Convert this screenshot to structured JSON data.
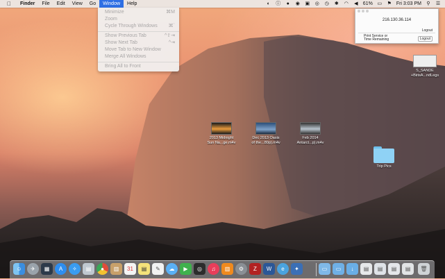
{
  "menubar": {
    "apple": "",
    "app_name": "Finder",
    "menus": [
      "File",
      "Edit",
      "View",
      "Go",
      "Window",
      "Help"
    ],
    "active_menu": "Window",
    "battery": "61%",
    "clock": "Fri 3:03 PM"
  },
  "window_menu": {
    "items": [
      {
        "label": "Minimize",
        "shortcut": "⌘M"
      },
      {
        "label": "Zoom",
        "shortcut": ""
      },
      {
        "label": "Cycle Through Windows",
        "shortcut": "⌘`"
      },
      {
        "label": "Show Previous Tab",
        "shortcut": "^⇧⇥"
      },
      {
        "label": "Show Next Tab",
        "shortcut": "^⇥"
      },
      {
        "label": "Move Tab to New Window",
        "shortcut": ""
      },
      {
        "label": "Merge All Windows",
        "shortcut": ""
      },
      {
        "label": "Bring All to Front",
        "shortcut": ""
      }
    ]
  },
  "popup_window": {
    "ip": "216.130.36.114",
    "logout_label": "Logout",
    "print_label_1": "Print Service or",
    "print_label_2": "Time Remaining",
    "logout_button": "Logout"
  },
  "desktop_icons": [
    {
      "line1": "2013 Midnight",
      "line2": "Sun Na...ge.m4v"
    },
    {
      "line1": "Dec 2013 Oasis",
      "line2": "of the...80p).m4v"
    },
    {
      "line1": "Feb 2014",
      "line2": "Antarct...p).m4v"
    },
    {
      "line1": "Trip Pics",
      "line2": ""
    },
    {
      "line1": "S_SANDE",
      "line2": "+BirisA...ndLegs"
    }
  ],
  "dock": {
    "apps": [
      "finder-icon",
      "launchpad-icon",
      "mission-control-icon",
      "app-store-icon",
      "safari-icon",
      "preview-icon",
      "chrome-icon",
      "notes-icon",
      "calendar-icon",
      "stickies-icon",
      "textedit-icon",
      "messages-icon",
      "facetime-icon",
      "photo-booth-icon",
      "itunes-icon",
      "ibooks-icon",
      "system-preferences-icon",
      "filezilla-icon",
      "word-icon",
      "iexplorer-icon",
      "vpn-icon"
    ],
    "stacks": [
      "applications-stack-icon",
      "documents-stack-icon",
      "downloads-stack-icon",
      "screenshot-stack-1",
      "screenshot-stack-2",
      "screenshot-stack-3",
      "screenshot-stack-4",
      "trash-icon"
    ]
  }
}
